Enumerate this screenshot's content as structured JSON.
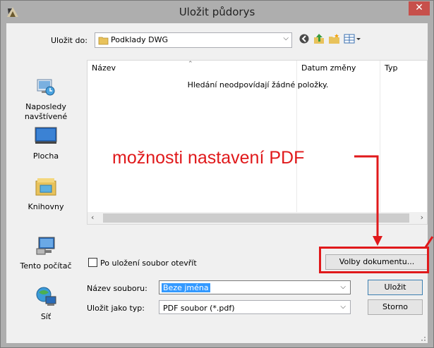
{
  "window": {
    "title": "Uložit půdorys",
    "close_glyph": "✕"
  },
  "save_in": {
    "label": "Uložit do:",
    "value": "Podklady DWG",
    "folder_icon": "folder-icon"
  },
  "toolbar": {
    "icons": [
      "back-icon",
      "up-folder-icon",
      "new-folder-icon",
      "view-menu-icon"
    ]
  },
  "places": [
    {
      "label_line1": "Naposledy",
      "label_line2": "navštívené",
      "icon": "recent-places-icon"
    },
    {
      "label_line1": "Plocha",
      "label_line2": "",
      "icon": "desktop-icon"
    },
    {
      "label_line1": "Knihovny",
      "label_line2": "",
      "icon": "libraries-icon"
    },
    {
      "label_line1": "Tento počítač",
      "label_line2": "",
      "icon": "computer-icon"
    },
    {
      "label_line1": "Síť",
      "label_line2": "",
      "icon": "network-icon"
    }
  ],
  "file_list": {
    "columns": [
      "Název",
      "Datum změny",
      "Typ"
    ],
    "sorted_column": "Název",
    "empty_message": "Hledání neodpovídají žádné položky."
  },
  "annotation": {
    "text": "možnosti nastavení PDF",
    "color": "#e0191b"
  },
  "options": {
    "open_after_save_label": "Po uložení soubor otevřít",
    "open_after_save_checked": false,
    "document_options_button": "Volby dokumentu..."
  },
  "filename": {
    "label": "Název souboru:",
    "value": "Beze jména"
  },
  "filetype": {
    "label": "Uložit jako typ:",
    "value": "PDF soubor (*.pdf)"
  },
  "buttons": {
    "save": "Uložit",
    "cancel": "Storno"
  }
}
